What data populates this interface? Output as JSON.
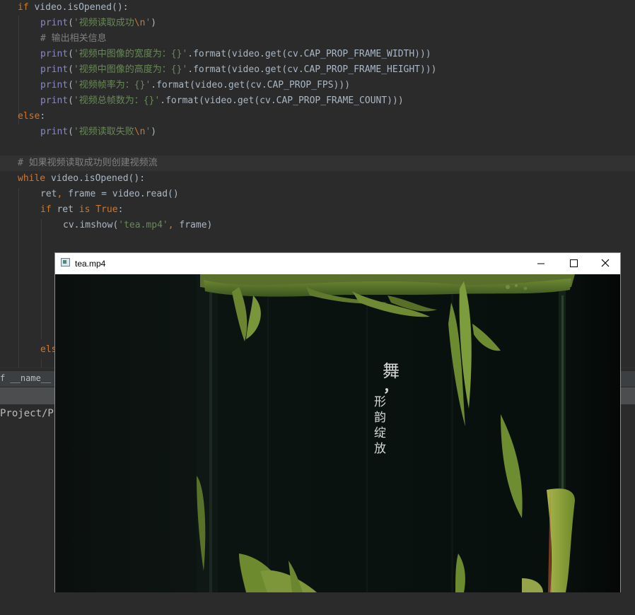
{
  "editor": {
    "lines": [
      {
        "indent": 0,
        "parts": [
          [
            "kw",
            "if "
          ],
          [
            "pl",
            "video.isOpened():"
          ]
        ]
      },
      {
        "indent": 1,
        "parts": [
          [
            "fn",
            "print"
          ],
          [
            "pl",
            "("
          ],
          [
            "str",
            "'视频读取成功"
          ],
          [
            "esc",
            "\\n"
          ],
          [
            "str",
            "'"
          ],
          [
            "pl",
            ")"
          ]
        ]
      },
      {
        "indent": 1,
        "parts": [
          [
            "cm",
            "# 输出相关信息"
          ]
        ]
      },
      {
        "indent": 1,
        "parts": [
          [
            "fn",
            "print"
          ],
          [
            "pl",
            "("
          ],
          [
            "str",
            "'视频中图像的宽度为：{}'"
          ],
          [
            "pl",
            ".format(video.get(cv.CAP_PROP_FRAME_WIDTH)))"
          ]
        ]
      },
      {
        "indent": 1,
        "parts": [
          [
            "fn",
            "print"
          ],
          [
            "pl",
            "("
          ],
          [
            "str",
            "'视频中图像的高度为：{}'"
          ],
          [
            "pl",
            ".format(video.get(cv.CAP_PROP_FRAME_HEIGHT)))"
          ]
        ]
      },
      {
        "indent": 1,
        "parts": [
          [
            "fn",
            "print"
          ],
          [
            "pl",
            "("
          ],
          [
            "str",
            "'视频帧率为：{}'"
          ],
          [
            "pl",
            ".format(video.get(cv.CAP_PROP_FPS)))"
          ]
        ]
      },
      {
        "indent": 1,
        "parts": [
          [
            "fn",
            "print"
          ],
          [
            "pl",
            "("
          ],
          [
            "str",
            "'视频总帧数为：{}'"
          ],
          [
            "pl",
            ".format(video.get(cv.CAP_PROP_FRAME_COUNT)))"
          ]
        ]
      },
      {
        "indent": 0,
        "parts": [
          [
            "kw",
            "else"
          ],
          [
            "pl",
            ":"
          ]
        ]
      },
      {
        "indent": 1,
        "parts": [
          [
            "fn",
            "print"
          ],
          [
            "pl",
            "("
          ],
          [
            "str",
            "'视频读取失败"
          ],
          [
            "esc",
            "\\n"
          ],
          [
            "str",
            "'"
          ],
          [
            "pl",
            ")"
          ]
        ]
      },
      {
        "indent": 0,
        "parts": []
      },
      {
        "indent": 0,
        "parts": [
          [
            "cm",
            "# 如果视频读取成功则创建视频流"
          ]
        ],
        "highlight": true
      },
      {
        "indent": 0,
        "parts": [
          [
            "kw",
            "while "
          ],
          [
            "pl",
            "video.isOpened():"
          ]
        ]
      },
      {
        "indent": 1,
        "parts": [
          [
            "pl",
            "ret"
          ],
          [
            "kw",
            ", "
          ],
          [
            "pl",
            "frame = video.read()"
          ]
        ]
      },
      {
        "indent": 1,
        "parts": [
          [
            "kw",
            "if "
          ],
          [
            "pl",
            "ret "
          ],
          [
            "kw",
            "is True"
          ],
          [
            "pl",
            ":"
          ]
        ]
      },
      {
        "indent": 2,
        "parts": [
          [
            "pl",
            "cv.imshow("
          ],
          [
            "str",
            "'tea.mp4'"
          ],
          [
            "kw",
            ", "
          ],
          [
            "pl",
            "frame)"
          ]
        ]
      }
    ],
    "partial_else": "els",
    "name_main": "f __name__ ==",
    "project_path": "Project/Py"
  },
  "window": {
    "title": "tea.mp4",
    "minimize_glyph": "—",
    "maximize_glyph": "☐",
    "close_glyph": "✕"
  },
  "video_text": {
    "big": "舞",
    "comma": "，",
    "small": [
      "形",
      "韵",
      "绽",
      "放"
    ]
  }
}
